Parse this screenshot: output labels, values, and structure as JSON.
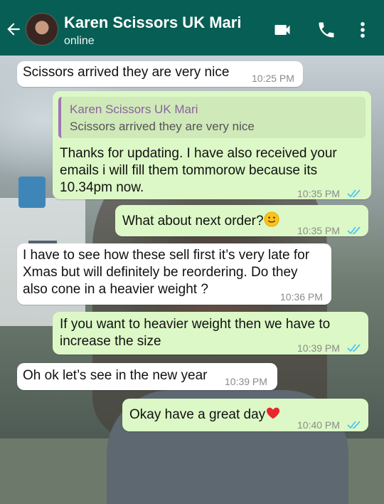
{
  "header": {
    "contact_name": "Karen Scissors UK Mari",
    "status": "online",
    "icons": [
      "back-arrow-icon",
      "video-call-icon",
      "phone-icon",
      "more-vert-icon"
    ],
    "color": "#075e54"
  },
  "messages": [
    {
      "direction": "incoming",
      "text": "Scissors arrived they are very nice",
      "time": "10:25 PM"
    },
    {
      "direction": "outgoing",
      "quoted": {
        "name": "Karen Scissors UK Mari",
        "text": "Scissors arrived they are very nice"
      },
      "lines": [
        "Thanks for updating. I have also received your",
        "emails i will fill them tommorow because its",
        "10.34pm now."
      ],
      "time": "10:35 PM",
      "read": true
    },
    {
      "direction": "outgoing",
      "text": "What about next order?",
      "emoji": "slightly-smiling-face",
      "time": "10:35 PM",
      "read": true
    },
    {
      "direction": "incoming",
      "lines": [
        "I have to see how these sell first it’s very late for",
        "Xmas but will definitely be reordering. Do they",
        "also cone in a heavier weight ?"
      ],
      "time": "10:36 PM"
    },
    {
      "direction": "outgoing",
      "lines": [
        "If you want to heavier weight then we have to",
        "increase the size"
      ],
      "time": "10:39 PM",
      "read": true
    },
    {
      "direction": "incoming",
      "text": "Oh ok let’s see in the new year",
      "time": "10:39 PM"
    },
    {
      "direction": "outgoing",
      "text": "Okay have a great day",
      "emoji": "red-heart",
      "time": "10:40 PM",
      "read": true
    }
  ],
  "colors": {
    "incoming_bubble": "#ffffff",
    "outgoing_bubble": "#dcf8c6",
    "read_ticks": "#4fc3f7"
  }
}
